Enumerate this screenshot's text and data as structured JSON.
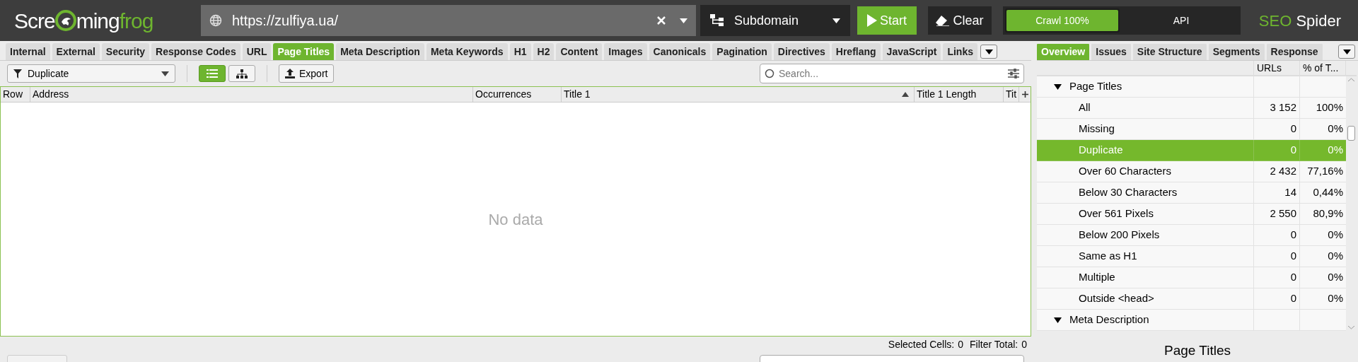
{
  "logo": {
    "before": "Scre",
    "after": "ming",
    "accent": "frog"
  },
  "url_field": {
    "value": "https://zulfiya.ua/"
  },
  "mode_dropdown": {
    "value": "Subdomain"
  },
  "buttons": {
    "start": "Start",
    "clear": "Clear"
  },
  "crawl_progress": {
    "label": "Crawl 100%",
    "level": 1
  },
  "api_button": "API",
  "product_name": {
    "accent": "SEO",
    "rest": "Spider"
  },
  "tabs": [
    {
      "label": "Internal",
      "selected": false
    },
    {
      "label": "External",
      "selected": false
    },
    {
      "label": "Security",
      "selected": false
    },
    {
      "label": "Response Codes",
      "selected": false
    },
    {
      "label": "URL",
      "selected": false
    },
    {
      "label": "Page Titles",
      "selected": true
    },
    {
      "label": "Meta Description",
      "selected": false
    },
    {
      "label": "Meta Keywords",
      "selected": false
    },
    {
      "label": "H1",
      "selected": false
    },
    {
      "label": "H2",
      "selected": false
    },
    {
      "label": "Content",
      "selected": false
    },
    {
      "label": "Images",
      "selected": false
    },
    {
      "label": "Canonicals",
      "selected": false
    },
    {
      "label": "Pagination",
      "selected": false
    },
    {
      "label": "Directives",
      "selected": false
    },
    {
      "label": "Hreflang",
      "selected": false
    },
    {
      "label": "JavaScript",
      "selected": false
    },
    {
      "label": "Links",
      "selected": false
    }
  ],
  "filter_dropdown": {
    "value": "Duplicate"
  },
  "view_toggle": [
    {
      "kind": "list",
      "selected": true
    },
    {
      "kind": "tree",
      "selected": false
    }
  ],
  "export_button": "Export",
  "search": {
    "placeholder": "Search..."
  },
  "table": {
    "columns": [
      {
        "label": "Row"
      },
      {
        "label": "Address"
      },
      {
        "label": "Occurrences"
      },
      {
        "label": "Title 1",
        "sorted": true
      },
      {
        "label": "Title 1 Length"
      },
      {
        "label": "Tit"
      }
    ],
    "empty_text": "No data"
  },
  "status_bar": {
    "selected_label": "Selected Cells:",
    "selected_value": "0",
    "filter_label": "Filter Total:",
    "filter_value": "0"
  },
  "right_tabs": [
    {
      "label": "Overview",
      "selected": true
    },
    {
      "label": "Issues",
      "selected": false
    },
    {
      "label": "Site Structure",
      "selected": false
    },
    {
      "label": "Segments",
      "selected": false
    },
    {
      "label": "Response",
      "selected": false
    }
  ],
  "overview": {
    "columns": [
      "URLs",
      "% of T..."
    ],
    "groups": [
      {
        "label": "Page Titles",
        "expanded": true,
        "children": [
          {
            "label": "All",
            "urls": "3 152",
            "percent": "100%",
            "selected": false
          },
          {
            "label": "Missing",
            "urls": "0",
            "percent": "0%",
            "selected": false
          },
          {
            "label": "Duplicate",
            "urls": "0",
            "percent": "0%",
            "selected": true
          },
          {
            "label": "Over 60 Characters",
            "urls": "2 432",
            "percent": "77,16%",
            "selected": false
          },
          {
            "label": "Below 30 Characters",
            "urls": "14",
            "percent": "0,44%",
            "selected": false
          },
          {
            "label": "Over 561 Pixels",
            "urls": "2 550",
            "percent": "80,9%",
            "selected": false
          },
          {
            "label": "Below 200 Pixels",
            "urls": "0",
            "percent": "0%",
            "selected": false
          },
          {
            "label": "Same as H1",
            "urls": "0",
            "percent": "0%",
            "selected": false
          },
          {
            "label": "Multiple",
            "urls": "0",
            "percent": "0%",
            "selected": false
          },
          {
            "label": "Outside <head>",
            "urls": "0",
            "percent": "0%",
            "selected": false
          }
        ]
      },
      {
        "label": "Meta Description",
        "expanded": true
      }
    ]
  },
  "detail_title": "Page Titles"
}
